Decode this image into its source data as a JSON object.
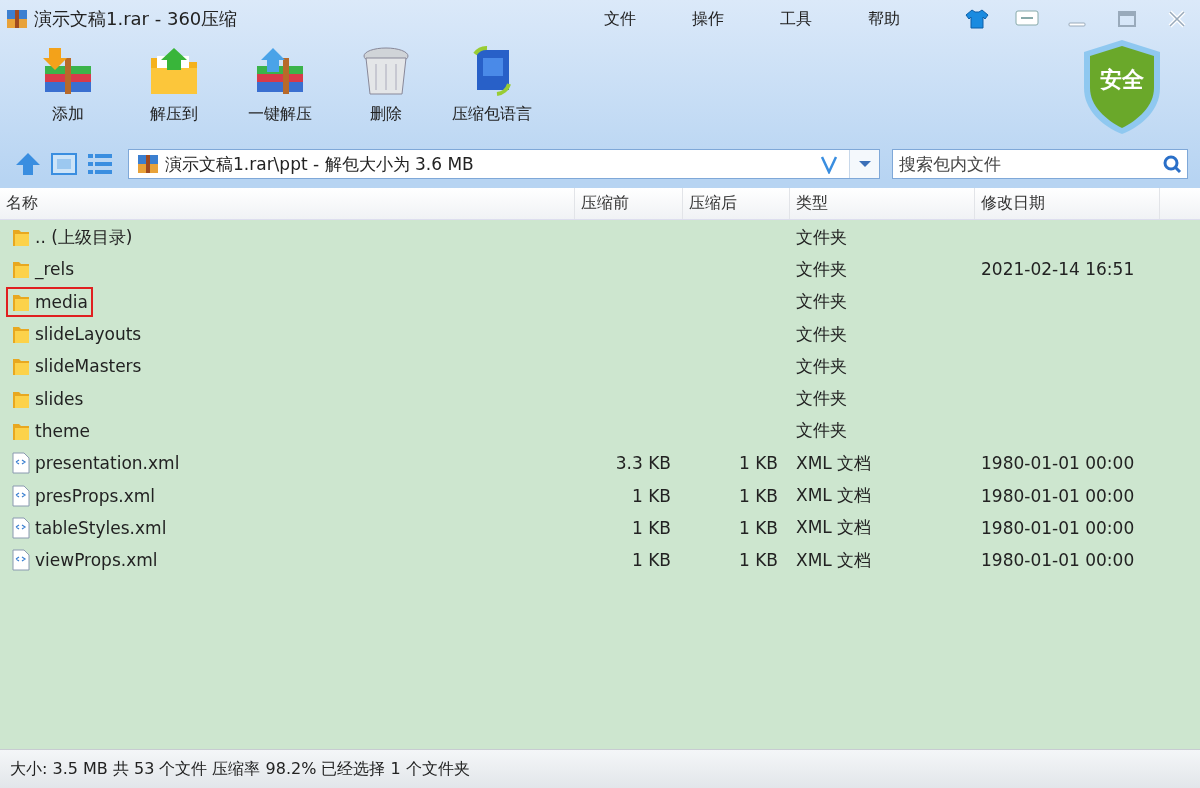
{
  "window": {
    "title": "演示文稿1.rar - 360压缩"
  },
  "menu": [
    "文件",
    "操作",
    "工具",
    "帮助"
  ],
  "toolbar": [
    {
      "label": "添加",
      "kind": "add"
    },
    {
      "label": "解压到",
      "kind": "extract"
    },
    {
      "label": "一键解压",
      "kind": "oneclick"
    },
    {
      "label": "删除",
      "kind": "delete"
    },
    {
      "label": "压缩包语言",
      "kind": "language"
    }
  ],
  "security_badge": "安全",
  "address": {
    "value": "演示文稿1.rar\\ppt - 解包大小为 3.6 MB"
  },
  "search": {
    "placeholder": "搜索包内文件"
  },
  "table": {
    "columns": [
      "名称",
      "压缩前",
      "压缩后",
      "类型",
      "修改日期"
    ],
    "rows": [
      {
        "name": ".. (上级目录)",
        "kind": "folder",
        "before": "",
        "after": "",
        "type": "文件夹",
        "date": "",
        "highlighted": false
      },
      {
        "name": "_rels",
        "kind": "folder",
        "before": "",
        "after": "",
        "type": "文件夹",
        "date": "2021-02-14 16:51",
        "highlighted": false
      },
      {
        "name": "media",
        "kind": "folder",
        "before": "",
        "after": "",
        "type": "文件夹",
        "date": "",
        "highlighted": true
      },
      {
        "name": "slideLayouts",
        "kind": "folder",
        "before": "",
        "after": "",
        "type": "文件夹",
        "date": "",
        "highlighted": false
      },
      {
        "name": "slideMasters",
        "kind": "folder",
        "before": "",
        "after": "",
        "type": "文件夹",
        "date": "",
        "highlighted": false
      },
      {
        "name": "slides",
        "kind": "folder",
        "before": "",
        "after": "",
        "type": "文件夹",
        "date": "",
        "highlighted": false
      },
      {
        "name": "theme",
        "kind": "folder",
        "before": "",
        "after": "",
        "type": "文件夹",
        "date": "",
        "highlighted": false
      },
      {
        "name": "presentation.xml",
        "kind": "xml",
        "before": "3.3 KB",
        "after": "1 KB",
        "type": "XML 文档",
        "date": "1980-01-01 00:00",
        "highlighted": false
      },
      {
        "name": "presProps.xml",
        "kind": "xml",
        "before": "1 KB",
        "after": "1 KB",
        "type": "XML 文档",
        "date": "1980-01-01 00:00",
        "highlighted": false
      },
      {
        "name": "tableStyles.xml",
        "kind": "xml",
        "before": "1 KB",
        "after": "1 KB",
        "type": "XML 文档",
        "date": "1980-01-01 00:00",
        "highlighted": false
      },
      {
        "name": "viewProps.xml",
        "kind": "xml",
        "before": "1 KB",
        "after": "1 KB",
        "type": "XML 文档",
        "date": "1980-01-01 00:00",
        "highlighted": false
      }
    ]
  },
  "status_bar": "大小: 3.5 MB 共 53 个文件 压缩率 98.2% 已经选择 1 个文件夹"
}
